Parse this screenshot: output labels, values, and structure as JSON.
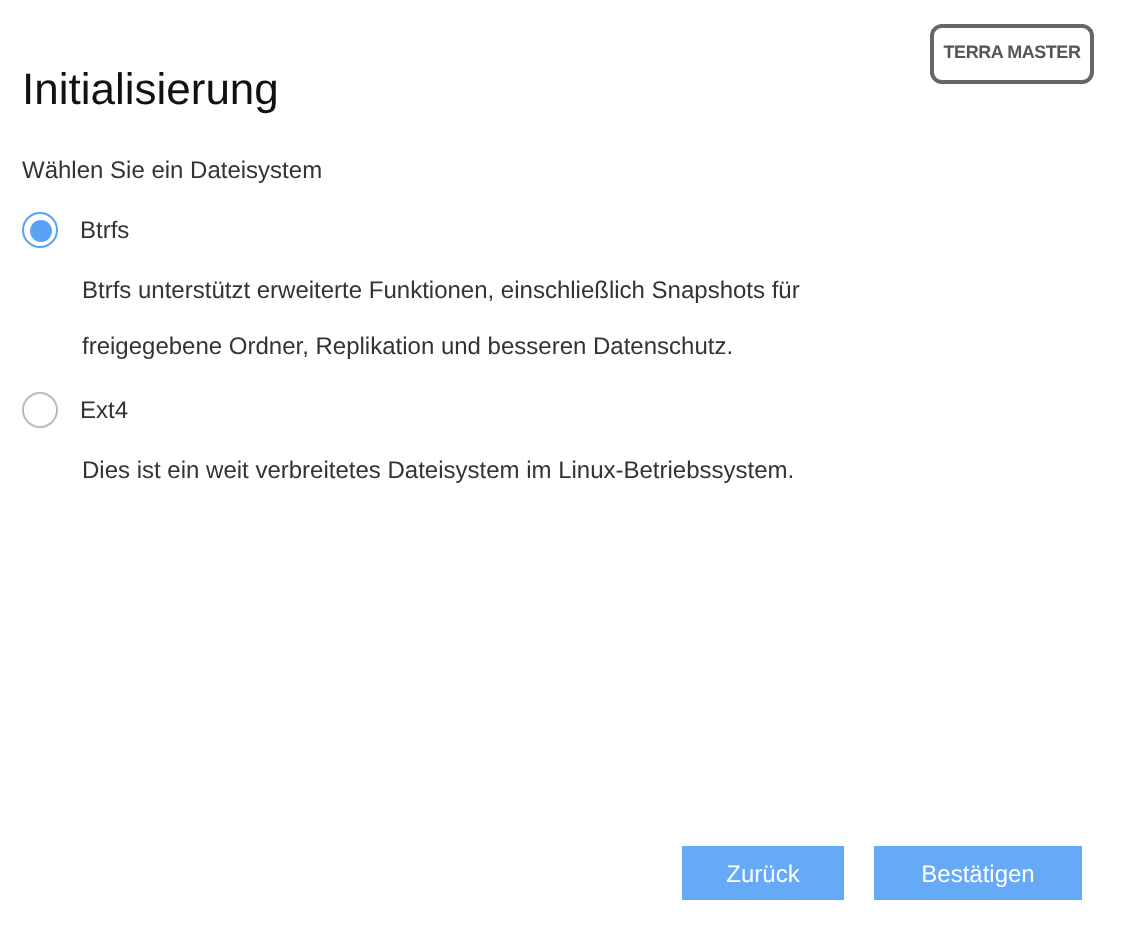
{
  "logo": "TERRA MASTER",
  "title": "Initialisierung",
  "prompt": "Wählen Sie ein Dateisystem",
  "options": [
    {
      "label": "Btrfs",
      "selected": true,
      "description": "Btrfs unterstützt erweiterte Funktionen, einschließlich Snapshots für freigegebene Ordner, Replikation und besseren Datenschutz."
    },
    {
      "label": "Ext4",
      "selected": false,
      "description": "Dies ist ein weit verbreitetes Dateisystem im Linux-Betriebssystem."
    }
  ],
  "buttons": [
    "Zurück",
    "Bestätigen"
  ]
}
